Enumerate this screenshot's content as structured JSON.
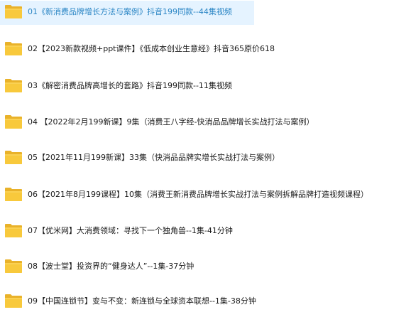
{
  "folders": [
    {
      "name": "01《新消费品牌增长方法与案例》抖音199同款--44集视频",
      "selected": true
    },
    {
      "name": "02【2023新款视频+ppt课件】《低成本创业生意经》抖音365原价618",
      "selected": false
    },
    {
      "name": "03《解密消费品牌高增长的套路》抖音199同款--11集视频",
      "selected": false
    },
    {
      "name": "04 【2022年2月199新课】9集（消费王八字经-快消品品牌增长实战打法与案例）",
      "selected": false
    },
    {
      "name": "05【2021年11月199新课】33集（快消品品牌实增长实战打法与案例）",
      "selected": false
    },
    {
      "name": "06【2021年8月199课程】10集（消费王新消费品牌增长实战打法与案例拆解品牌打造视频课程）",
      "selected": false
    },
    {
      "name": "07【优米网】大消费领域：寻找下一个独角兽--1集-41分钟",
      "selected": false
    },
    {
      "name": "08【波士堂】投资界的“健身达人”--1集-37分钟",
      "selected": false
    },
    {
      "name": "09【中国连锁节】变与不变：新连锁与全球资本联想--1集-38分钟",
      "selected": false
    }
  ],
  "colors": {
    "folder_body": "#f8c93c",
    "folder_tab": "#e9b22a",
    "folder_front": "#fcd96a",
    "selected_text": "#2b86c5",
    "selected_bg": "#e5f3ff"
  }
}
